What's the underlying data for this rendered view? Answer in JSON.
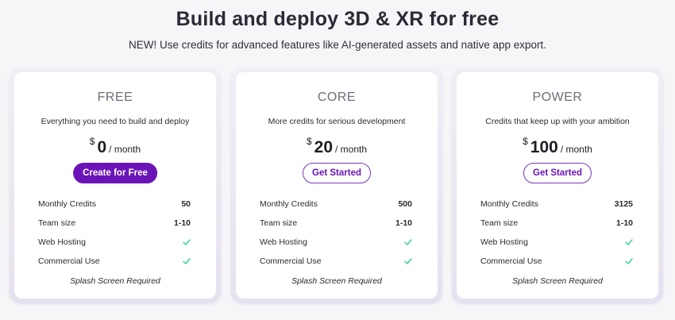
{
  "header": {
    "title": "Build and deploy 3D & XR for free",
    "subtitle": "NEW! Use credits for advanced features like AI-generated assets and native app export."
  },
  "colors": {
    "accent": "#6a14b8",
    "check": "#2fd18f"
  },
  "plans": [
    {
      "name": "FREE",
      "description": "Everything you need to build and deploy",
      "currency": "$",
      "price": "0",
      "period": "/ month",
      "cta": "Create for Free",
      "cta_style": "primary",
      "features": [
        {
          "label": "Monthly Credits",
          "value": "50"
        },
        {
          "label": "Team size",
          "value": "1-10"
        },
        {
          "label": "Web Hosting",
          "icon": "check-icon"
        },
        {
          "label": "Commercial Use",
          "icon": "check-icon"
        }
      ],
      "note": "Splash Screen Required"
    },
    {
      "name": "CORE",
      "description": "More credits for serious development",
      "currency": "$",
      "price": "20",
      "period": "/ month",
      "cta": "Get Started",
      "cta_style": "outline",
      "features": [
        {
          "label": "Monthly Credits",
          "value": "500"
        },
        {
          "label": "Team size",
          "value": "1-10"
        },
        {
          "label": "Web Hosting",
          "icon": "check-icon"
        },
        {
          "label": "Commercial Use",
          "icon": "check-icon"
        }
      ],
      "note": "Splash Screen Required"
    },
    {
      "name": "POWER",
      "description": "Credits that keep up with your ambition",
      "currency": "$",
      "price": "100",
      "period": "/ month",
      "cta": "Get Started",
      "cta_style": "outline",
      "features": [
        {
          "label": "Monthly Credits",
          "value": "3125"
        },
        {
          "label": "Team size",
          "value": "1-10"
        },
        {
          "label": "Web Hosting",
          "icon": "check-icon"
        },
        {
          "label": "Commercial Use",
          "icon": "check-icon"
        }
      ],
      "note": "Splash Screen Required"
    }
  ]
}
